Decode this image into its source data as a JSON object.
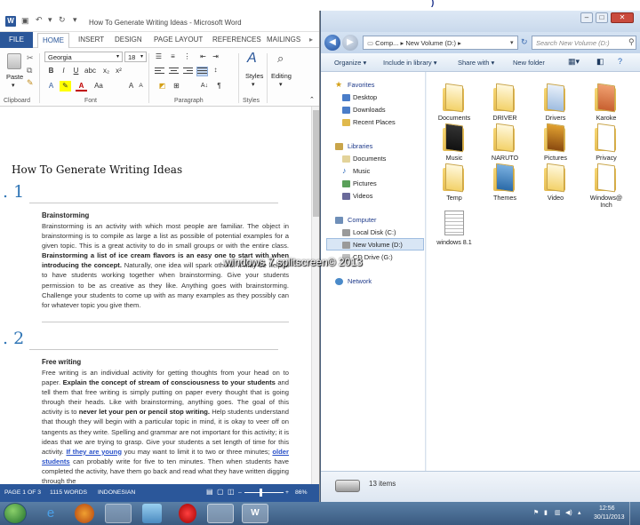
{
  "desktop": {
    "top_mark": ")"
  },
  "word": {
    "title": "How To Generate Writing Ideas - Microsoft Word",
    "app_icon": "W",
    "tabs": [
      "FILE",
      "HOME",
      "INSERT",
      "DESIGN",
      "PAGE LAYOUT",
      "REFERENCES",
      "MAILINGS"
    ],
    "clipboard": {
      "paste_label": "Paste",
      "group": "Clipboard"
    },
    "font": {
      "family": "Georgia",
      "size": "18",
      "group": "Font",
      "bold": "B",
      "italic": "I",
      "underline": "U",
      "case": "Aa",
      "grow": "A",
      "shrink": "A"
    },
    "paragraph": {
      "group": "Paragraph",
      "sort": "A↓",
      "pilcrow": "¶"
    },
    "styles": {
      "label": "Styles",
      "group": "Styles"
    },
    "editing": {
      "label": "Editing"
    },
    "doc": {
      "title": "How To Generate Writing Ideas",
      "sections": [
        {
          "num": ". 1",
          "heading": "Brainstorming",
          "p1": "Brainstorming is an activity with which most people are familiar. The object in brainstorming is to compile as large a list as possible of potential examples for a given topic. This is a great activity to do in small groups or with the entire class.",
          "p1_bold": "Brainstorming a list of ice cream flavors is an easy one to start with when introducing the concept.",
          "p1_rest": "Naturally, one idea will spark others. It may be helpful to have students working together when brainstorming. Give your students permission to be as creative as they like. Anything goes with brainstorming. Challenge your students to come up with as many examples as they possibly can for whatever topic you give them."
        },
        {
          "num": ". 2",
          "heading": "Free writing",
          "p1": "Free writing is an individual activity for getting thoughts from your head on to paper.",
          "p1_bold": "Explain the concept of stream of consciousness to your students",
          "p1_b": "and tell them that free writing is simply putting on paper every thought that is going through their heads. Like with brainstorming, anything goes. The goal of this activity is to",
          "p1_bold2": "never let your pen or pencil stop writing.",
          "p1_c": "Help students understand that though they will begin with a particular topic in mind, it is okay to veer off on tangents as they write. Spelling and grammar are not important for this activity; it is ideas that we are trying to grasp. Give your students a set length of time for this activity.",
          "link1": "If they are young",
          "p1_d": "you may want to limit it to two or three minutes;",
          "link2": "older students",
          "p1_e": "can probably write for five to ten minutes. Then when students have completed the activity, have them go back and read what they have written digging through the"
        }
      ]
    },
    "status": {
      "page": "PAGE 1 OF 3",
      "words": "1115 WORDS",
      "lang": "INDONESIAN",
      "zoom": "86%",
      "zoom_value": 86
    }
  },
  "explorer": {
    "address": "Comp... ▸ New Volume (D:) ▸",
    "search_placeholder": "Search New Volume (D:)",
    "commands": [
      "Organize ▾",
      "Include in library ▾",
      "Share with ▾",
      "New folder"
    ],
    "nav": {
      "favorites": "Favorites",
      "fav_items": [
        "Desktop",
        "Downloads",
        "Recent Places"
      ],
      "libraries": "Libraries",
      "lib_items": [
        "Documents",
        "Music",
        "Pictures",
        "Videos"
      ],
      "computer": "Computer",
      "comp_items": [
        "Local Disk (C:)",
        "New Volume (D:)",
        "CD Drive (G:)"
      ],
      "network": "Network"
    },
    "files": [
      "Documents",
      "DRIVER",
      "Drivers",
      "Karoke",
      "Music",
      "NARUTO",
      "Pictures",
      "Privacy",
      "Temp",
      "Themes",
      "Video",
      "Windows@ Inch",
      "windows 8.1"
    ],
    "status": "13 items"
  },
  "watermark": "windows 7 splitscreen© 2013",
  "taskbar": {
    "time": "12:56",
    "date": "30/11/2013"
  },
  "colors": {
    "word_accent": "#2b579a",
    "heading_blue": "#2e74b5",
    "folder": "#f3d26a",
    "taskbar": "#4a6d94"
  }
}
